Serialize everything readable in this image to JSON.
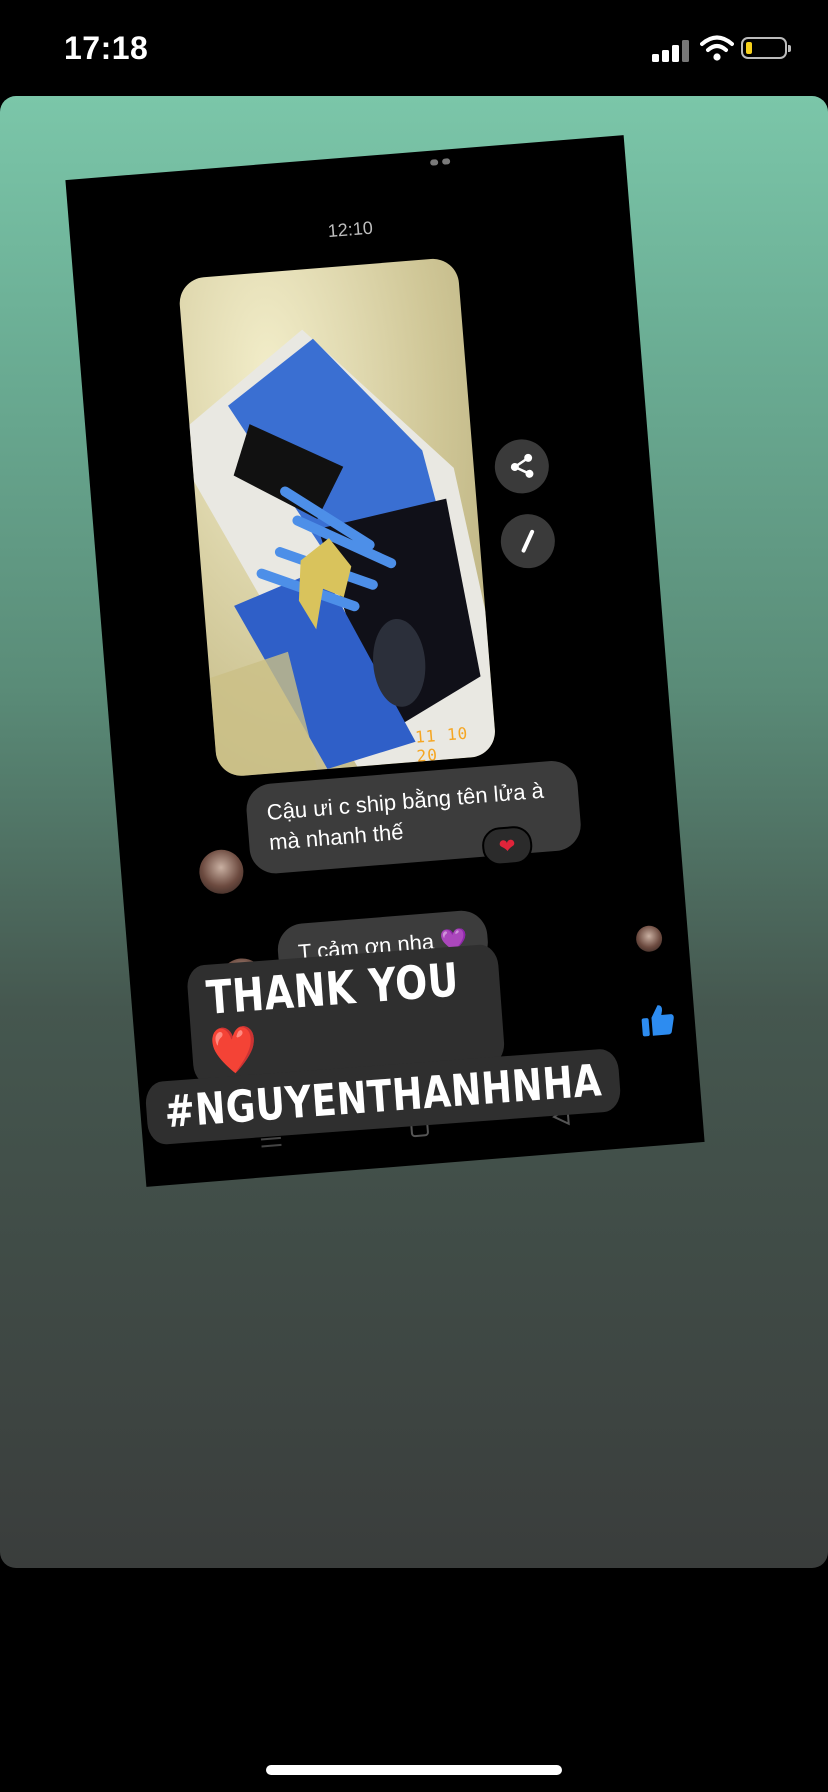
{
  "status_bar": {
    "time": "17:18"
  },
  "chat": {
    "timestamp": "12:10",
    "photo_stamp": "11 10 20",
    "messages": [
      {
        "text": "Cậu ưi c ship bằng tên lửa à mà nhanh thế",
        "reaction": "❤"
      },
      {
        "text": "T cảm ơn nha 💜",
        "reaction": "❤"
      }
    ]
  },
  "sticker": {
    "line1": "THANK YOU ❤️",
    "line2": "#NGUYENTHANHNHA"
  },
  "colors": {
    "accent_blue": "#2d8cf0",
    "heart_red": "#e0243a",
    "card_top": "#7bc6a9",
    "card_bottom": "#3a3d3c"
  },
  "icons": [
    "share-icon",
    "pencil-icon",
    "heart-icon",
    "like-icon",
    "dots-icon",
    "menu-icon",
    "home-icon",
    "back-icon"
  ]
}
